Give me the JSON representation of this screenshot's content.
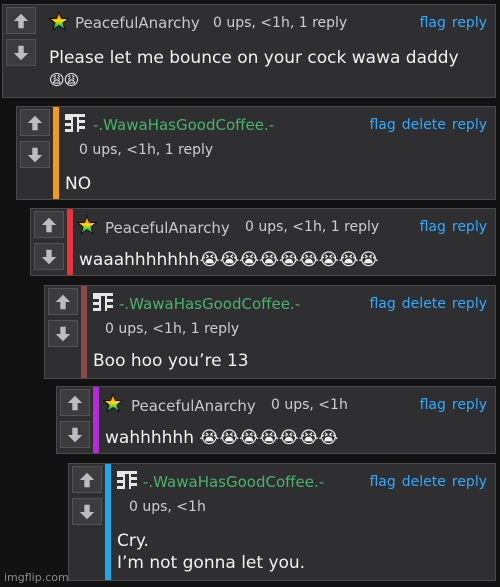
{
  "actions": {
    "flag": "flag",
    "delete": "delete",
    "reply": "reply"
  },
  "comments": [
    {
      "username": "PeacefulAnarchy",
      "meta": "0 ups, <1h, 1 reply",
      "line1": "Please let me bounce on your cock wawa daddy",
      "line2": "😩😩"
    },
    {
      "username": "-.WawaHasGoodCoffee.-",
      "meta": "0 ups, <1h, 1 reply",
      "line1": "NO",
      "accent_color": "#f29a1a"
    },
    {
      "username": "PeacefulAnarchy",
      "meta": "0 ups, <1h, 1 reply",
      "line1": "waaahhhhhhh😭😭😭😭😭😭😭😭😭",
      "accent_color": "#e8323c"
    },
    {
      "username": "-.WawaHasGoodCoffee.-",
      "meta": "0 ups, <1h, 1 reply",
      "line1": "Boo hoo you’re 13",
      "accent_color": "#8a4a4a"
    },
    {
      "username": "PeacefulAnarchy",
      "meta": "0 ups, <1h",
      "line1": "wahhhhhh 😭😭😭😭😭😭😭",
      "accent_color": "#b52bd6"
    },
    {
      "username": "-.WawaHasGoodCoffee.-",
      "meta": "0 ups, <1h",
      "line1": "Cry.",
      "line2": "I’m not gonna let you.",
      "accent_color": "#22a6e8"
    }
  ],
  "watermark": "imgflip.com"
}
